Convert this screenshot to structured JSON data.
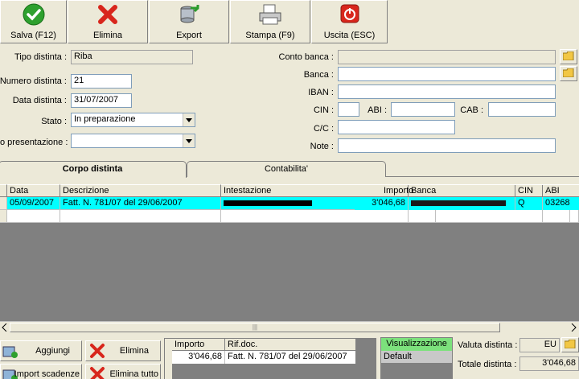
{
  "toolbar": {
    "save_label": "Salva (F12)",
    "delete_label": "Elimina",
    "export_label": "Export",
    "print_label": "Stampa (F9)",
    "exit_label": "Uscita (ESC)"
  },
  "form": {
    "tipo_label": "Tipo distinta :",
    "tipo_value": "Riba",
    "numero_label": "Numero distinta :",
    "numero_value": "21",
    "data_label": "Data distinta :",
    "data_value": "31/07/2007",
    "stato_label": "Stato :",
    "stato_value": "In preparazione",
    "presentazione_label": "o presentazione :",
    "presentazione_value": "",
    "conto_label": "Conto banca :",
    "conto_value": "",
    "banca_label": "Banca :",
    "banca_value": "",
    "iban_label": "IBAN :",
    "iban_value": "",
    "cin_label": "CIN :",
    "cin_value": "",
    "abi_label": "ABI :",
    "abi_value": "",
    "cab_label": "CAB :",
    "cab_value": "",
    "cc_label": "C/C :",
    "cc_value": "",
    "note_label": "Note :",
    "note_value": ""
  },
  "tabs": [
    {
      "label": "Corpo distinta",
      "active": true
    },
    {
      "label": "Contabilita'",
      "active": false
    }
  ],
  "grid": {
    "headers": [
      "Data",
      "Descrizione",
      "Intestazione",
      "Importo",
      "Banca",
      "CIN",
      "ABI"
    ],
    "rows": [
      {
        "data": "05/09/2007",
        "descrizione": "Fatt. N. 781/07 del 29/06/2007",
        "intestazione": "",
        "importo": "3'046,68",
        "banca": "",
        "cin": "Q",
        "abi": "03268"
      }
    ],
    "selected_color": "#00ffff"
  },
  "bottom": {
    "add_label": "Aggiungi",
    "delete_label": "Elimina",
    "import_label": "Import scadenze",
    "delete_all_label": "Elimina tutto",
    "sub_headers": [
      "Importo",
      "Rif.doc."
    ],
    "sub_row": {
      "importo": "3'046,68",
      "rif": "Fatt. N. 781/07 del 29/06/2007"
    },
    "view_header": "Visualizzazione",
    "view_item": "Default",
    "valuta_label": "Valuta distinta :",
    "valuta_value": "EU",
    "totale_label": "Totale distinta :",
    "totale_value": "3'046,68"
  },
  "icons": {
    "save": "green-check-icon",
    "delete": "red-x-icon",
    "export": "database-export-icon",
    "print": "printer-icon",
    "exit": "power-icon",
    "folder": "folder-icon"
  }
}
